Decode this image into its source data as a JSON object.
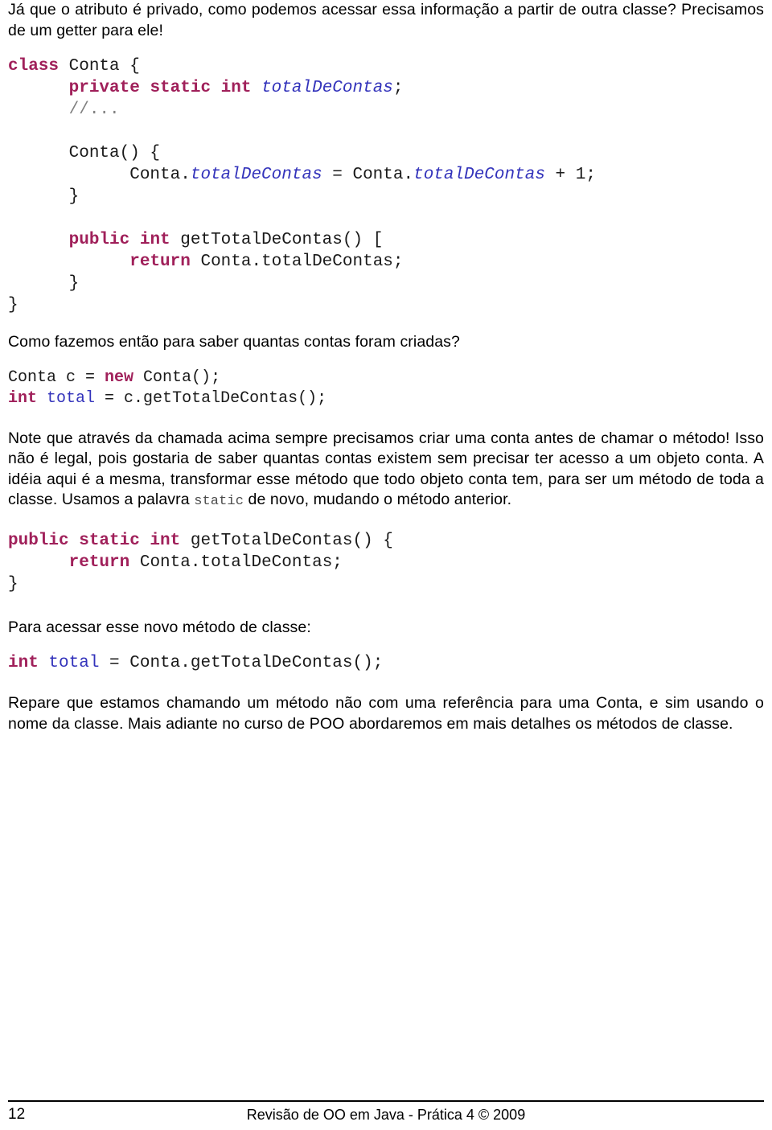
{
  "document": {
    "page_number": "12",
    "footer_text": "Revisão de OO em Java - Prática 4 © 2009"
  },
  "paragraphs": {
    "intro": "Já que o atributo é privado, como podemos acessar essa informação a partir de outra classe? Precisamos de um getter para ele!",
    "question_how": "Como fazemos então para saber quantas contas foram criadas?",
    "note_part1": "Note que através da chamada acima sempre precisamos criar uma conta antes de chamar o método! Isso não é legal, pois gostaria de saber quantas contas existem sem precisar ter acesso a um objeto conta. A idéia aqui é a mesma, transformar esse método que todo objeto conta tem, para ser um método de toda a classe. Usamos a palavra ",
    "note_static_word": "static",
    "note_part2": " de novo, mudando o método anterior.",
    "access_new_method": "Para acessar esse novo método de classe:",
    "closing": "Repare que estamos chamando um método não com uma referência para uma Conta, e sim usando o nome da classe. Mais adiante no curso de POO abordaremos em mais detalhes os métodos de classe."
  },
  "code_blocks": {
    "conta_class": {
      "lines": [
        [
          {
            "t": "class",
            "c": "kw"
          },
          {
            "t": " Conta {",
            "c": "plain"
          }
        ],
        [
          {
            "t": "      ",
            "c": "plain"
          },
          {
            "t": "private static int",
            "c": "kw"
          },
          {
            "t": " ",
            "c": "plain"
          },
          {
            "t": "totalDeContas",
            "c": "ident"
          },
          {
            "t": ";",
            "c": "plain"
          }
        ],
        [
          {
            "t": "      ",
            "c": "plain"
          },
          {
            "t": "//...",
            "c": "cmt"
          }
        ],
        [
          {
            "t": "",
            "c": "plain"
          }
        ],
        [
          {
            "t": "      Conta() {",
            "c": "plain"
          }
        ],
        [
          {
            "t": "            Conta.",
            "c": "plain"
          },
          {
            "t": "totalDeContas",
            "c": "ident"
          },
          {
            "t": " = Conta.",
            "c": "plain"
          },
          {
            "t": "totalDeContas",
            "c": "ident"
          },
          {
            "t": " + 1;",
            "c": "plain"
          }
        ],
        [
          {
            "t": "      }",
            "c": "plain"
          }
        ],
        [
          {
            "t": "",
            "c": "plain"
          }
        ],
        [
          {
            "t": "      ",
            "c": "plain"
          },
          {
            "t": "public int",
            "c": "kw"
          },
          {
            "t": " getTotalDeContas() [",
            "c": "plain"
          }
        ],
        [
          {
            "t": "            ",
            "c": "plain"
          },
          {
            "t": "return",
            "c": "kw"
          },
          {
            "t": " Conta.totalDeContas;",
            "c": "plain"
          }
        ],
        [
          {
            "t": "      }",
            "c": "plain"
          }
        ],
        [
          {
            "t": "}",
            "c": "plain"
          }
        ]
      ]
    },
    "usage_instance": {
      "lines": [
        [
          {
            "t": "Conta c = ",
            "c": "plain"
          },
          {
            "t": "new",
            "c": "kw"
          },
          {
            "t": " Conta();",
            "c": "plain"
          }
        ],
        [
          {
            "t": "int",
            "c": "kw"
          },
          {
            "t": " ",
            "c": "plain"
          },
          {
            "t": "total",
            "c": "var"
          },
          {
            "t": " = c.getTotalDeContas();",
            "c": "plain"
          }
        ]
      ]
    },
    "static_method": {
      "lines": [
        [
          {
            "t": "public static int",
            "c": "kw"
          },
          {
            "t": " getTotalDeContas() {",
            "c": "plain"
          }
        ],
        [
          {
            "t": "      ",
            "c": "plain"
          },
          {
            "t": "return",
            "c": "kw"
          },
          {
            "t": " Conta.totalDeContas;",
            "c": "plain"
          }
        ],
        [
          {
            "t": "}",
            "c": "plain"
          }
        ]
      ]
    },
    "usage_static": {
      "lines": [
        [
          {
            "t": "int",
            "c": "kw"
          },
          {
            "t": " ",
            "c": "plain"
          },
          {
            "t": "total",
            "c": "var"
          },
          {
            "t": " = Conta.getTotalDeContas();",
            "c": "plain"
          }
        ]
      ]
    }
  },
  "colors": {
    "keyword": "#a0205a",
    "identifier": "#3333bb",
    "comment": "#808080",
    "text": "#000000",
    "background": "#ffffff"
  }
}
